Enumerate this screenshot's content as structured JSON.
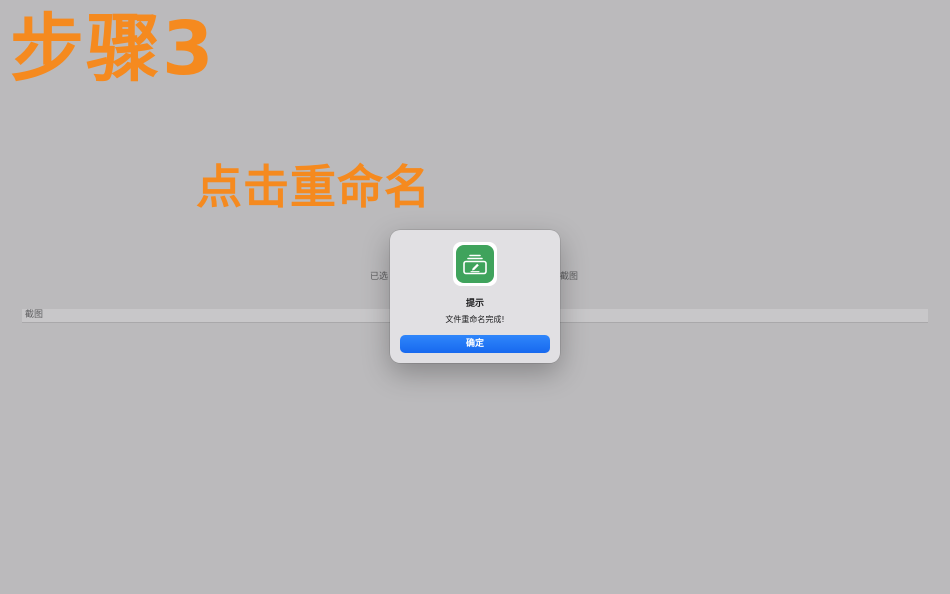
{
  "overlay": {
    "step_title": "步骤3",
    "instruction": "点击重命名"
  },
  "background": {
    "selection_info_left": "已选",
    "selection_info_right": "截图",
    "list_row_label": "截图"
  },
  "dialog": {
    "icon": "rename-app-icon",
    "title": "提示",
    "message": "文件重命名完成!",
    "ok_label": "确定"
  },
  "colors": {
    "annotation_orange": "#f58a1f",
    "accent_blue": "#1769ef",
    "icon_green": "#3fa35c",
    "dim_background": "#bbbabc"
  }
}
